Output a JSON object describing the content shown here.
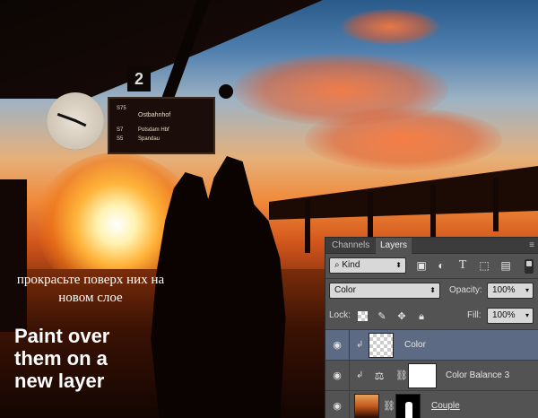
{
  "scene": {
    "platform_number": "2",
    "board_lines": [
      "S75",
      "Ostbahnhof",
      "S7",
      "Potsdam Hbf",
      "S5",
      "Spandau"
    ]
  },
  "captions": {
    "russian": "прокрасьте поверх них на новом слое",
    "english": "Paint over them on a new layer"
  },
  "layers_panel": {
    "tabs": [
      {
        "label": "Channels",
        "active": false
      },
      {
        "label": "Layers",
        "active": true
      }
    ],
    "menu_icon": "panel-menu-icon",
    "filter": {
      "kind_label": "Kind",
      "filter_icons": [
        "image-filter-icon",
        "adjustment-filter-icon",
        "type-filter-icon",
        "shape-filter-icon",
        "smart-object-filter-icon"
      ]
    },
    "blend_mode": "Color",
    "opacity_label": "Opacity:",
    "opacity_value": "100%",
    "lock_label": "Lock:",
    "lock_icons": [
      "lock-transparent-icon",
      "lock-paint-icon",
      "lock-move-icon",
      "lock-all-icon"
    ],
    "fill_label": "Fill:",
    "fill_value": "100%",
    "layers": [
      {
        "name": "Color",
        "selected": true,
        "visible": true,
        "clipped": true,
        "thumb": "transparent"
      },
      {
        "name": "Color Balance 3",
        "selected": false,
        "visible": true,
        "clipped": true,
        "thumb": "adjustment"
      },
      {
        "name": "Couple",
        "selected": false,
        "visible": true,
        "clipped": false,
        "thumb": "photo-with-mask"
      }
    ]
  },
  "colors": {
    "panel_bg": "#535353",
    "selected_layer": "#5d6a84",
    "caption_text": "#ffffff"
  }
}
